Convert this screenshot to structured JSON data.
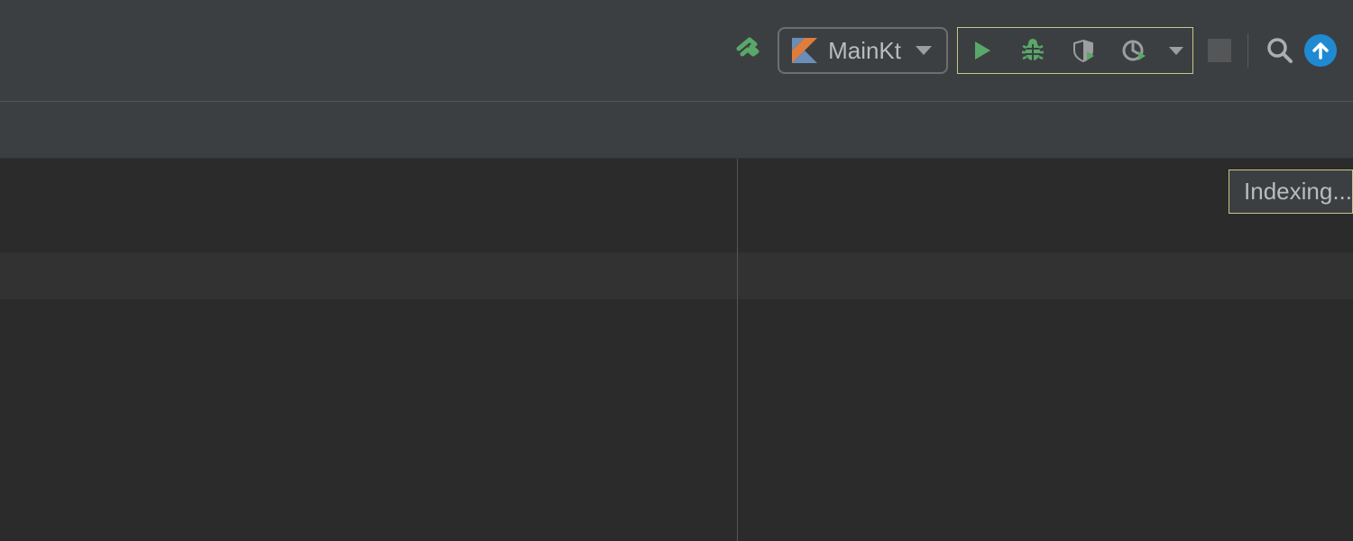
{
  "toolbar": {
    "run_config": {
      "label": "MainKt"
    }
  },
  "status": {
    "indexing": "Indexing..."
  },
  "colors": {
    "green": "#59a869",
    "gray": "#9e9e9e",
    "blue": "#1f8ad2",
    "kotlin_blue": "#6b8eb8",
    "kotlin_orange": "#de7d3c"
  }
}
